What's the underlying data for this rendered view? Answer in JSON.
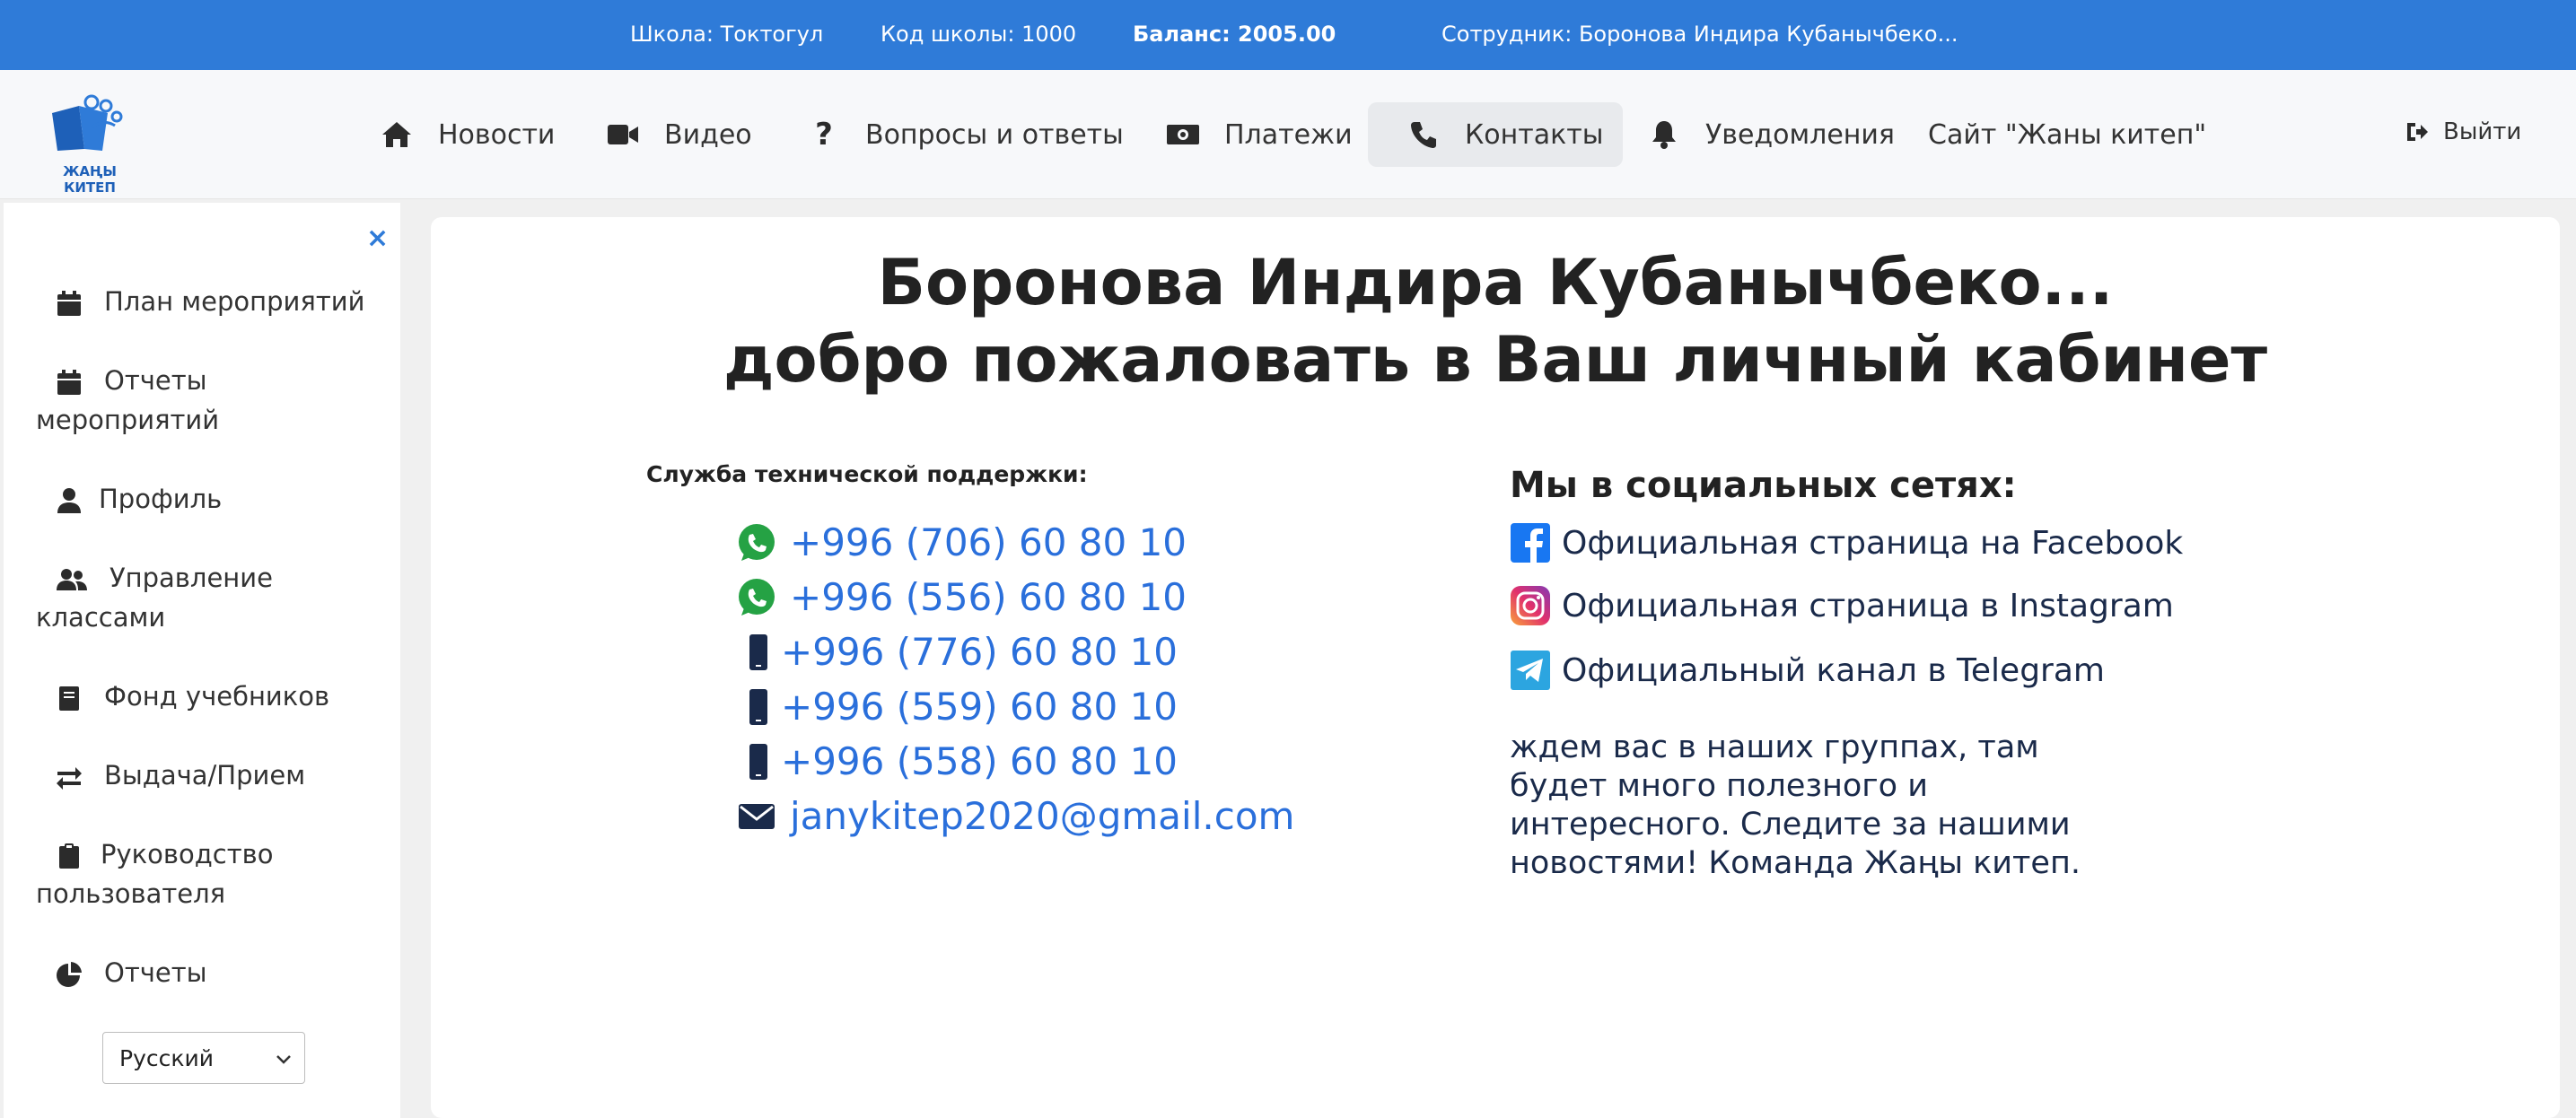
{
  "topbar": {
    "school": "Школа: Токтогул",
    "school_code": "Код школы: 1000",
    "balance": "Баланс: 2005.00",
    "employee": "Сотрудник: Боронова Индира Кубанычбеко..."
  },
  "logo": {
    "text": "ЖАҢЫ КИТЕП"
  },
  "nav": {
    "items": [
      {
        "label": "Новости",
        "icon": "home-icon"
      },
      {
        "label": "Видео",
        "icon": "video-icon"
      },
      {
        "label": "Вопросы и ответы",
        "icon": "question-icon"
      },
      {
        "label": "Платежи",
        "icon": "money-icon"
      },
      {
        "label": "Контакты",
        "icon": "phone-icon",
        "active": true
      },
      {
        "label": "Уведомления",
        "icon": "bell-icon"
      },
      {
        "label": "Сайт \"Жаны китеп\""
      }
    ],
    "logout": "Выйти"
  },
  "sidebar": {
    "close": "×",
    "items": [
      {
        "label": "План мероприятий",
        "icon": "calendar-icon"
      },
      {
        "label": "Отчеты мероприятий",
        "icon": "calendar-icon"
      },
      {
        "label": "Профиль",
        "icon": "user-icon"
      },
      {
        "label": "Управление классами",
        "icon": "users-icon"
      },
      {
        "label": "Фонд учебников",
        "icon": "book-icon"
      },
      {
        "label": "Выдача/Прием",
        "icon": "exchange-icon"
      },
      {
        "label": "Руководство пользователя",
        "icon": "clipboard-icon"
      },
      {
        "label": "Отчеты",
        "icon": "pie-chart-icon"
      }
    ],
    "language": {
      "selected": "Русский"
    }
  },
  "main": {
    "greeting_line1": "Боронова Индира Кубанычбеко...",
    "greeting_line2": "добро пожаловать в Ваш личный кабинет",
    "support_title": "Служба технической поддержки:",
    "contacts": [
      {
        "icon": "whatsapp-icon",
        "text": "+996 (706) 60 80 10"
      },
      {
        "icon": "whatsapp-icon",
        "text": "+996 (556) 60 80 10"
      },
      {
        "icon": "mobile-icon",
        "text": "+996 (776) 60 80 10"
      },
      {
        "icon": "mobile-icon",
        "text": "+996 (559) 60 80 10"
      },
      {
        "icon": "mobile-icon",
        "text": "+996 (558) 60 80 10"
      },
      {
        "icon": "envelope-icon",
        "text": "janykitep2020@gmail.com"
      }
    ],
    "social_title": "Мы в социальных сетях:",
    "socials": [
      {
        "icon": "facebook-icon",
        "text": "Официальная страница на Facebook"
      },
      {
        "icon": "instagram-icon",
        "text": "Официальная страница в Instagram"
      },
      {
        "icon": "telegram-icon",
        "text": "Официальный канал в Telegram"
      }
    ],
    "invite_text": "ждем вас в наших группах, там будет много полезного и интересного. Следите за нашими новостями! Команда Жаңы китеп."
  },
  "colors": {
    "topbar": "#2f7bd8",
    "link": "#2a6fdb",
    "whatsapp": "#25a244",
    "facebook": "#1877f2",
    "telegram": "#2ca5e0"
  }
}
